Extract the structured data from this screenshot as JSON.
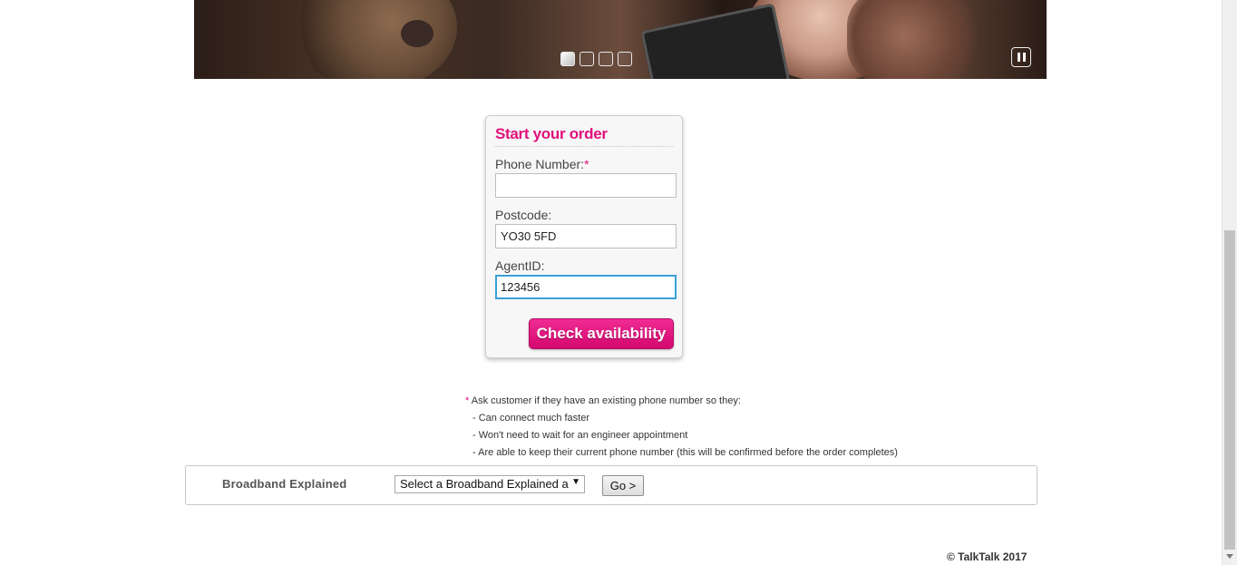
{
  "hero": {
    "slides": [
      {
        "active": true
      },
      {
        "active": false
      },
      {
        "active": false
      },
      {
        "active": false
      }
    ]
  },
  "order": {
    "title": "Start your order",
    "phone_label": "Phone Number:",
    "required_mark": "*",
    "phone_value": "",
    "postcode_label": "Postcode:",
    "postcode_value": "YO30 5FD",
    "agent_label": "AgentID:",
    "agent_value": "123456",
    "check_button": "Check availability"
  },
  "notes": {
    "mark": "*",
    "intro": " Ask customer if they have an existing phone number so they:",
    "lines": [
      "- Can connect much faster",
      "- Won't need to wait for an engineer appointment",
      "- Are able to keep their current phone number (this will be confirmed before the order completes)"
    ]
  },
  "broadband": {
    "label": "Broadband Explained",
    "select_value": "Select a Broadband Explained a",
    "go_button": "Go >"
  },
  "footer": {
    "copyright": "© TalkTalk 2017"
  },
  "colors": {
    "brand": "#e0107b",
    "focus": "#3aa0d8"
  },
  "icons": {
    "pause": "pause-icon",
    "dropdown": "chevron-down-icon"
  }
}
